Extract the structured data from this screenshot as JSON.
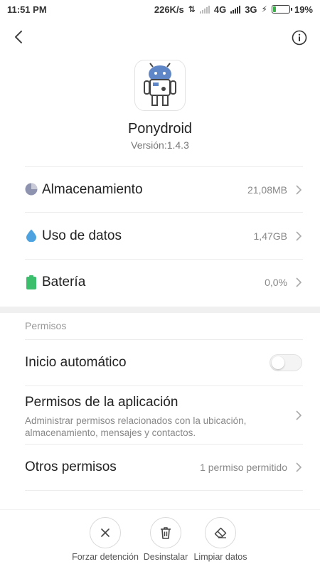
{
  "status_bar": {
    "time": "11:51 PM",
    "speed": "226K/s",
    "net1": "4G",
    "net2": "3G",
    "battery": "19%",
    "battery_level": 0.19
  },
  "app": {
    "name": "Ponydroid",
    "version": "Versión:1.4.3"
  },
  "usage": {
    "storage": {
      "label": "Almacenamiento",
      "value": "21,08MB"
    },
    "data": {
      "label": "Uso de datos",
      "value": "1,47GB"
    },
    "battery": {
      "label": "Batería",
      "value": "0,0%"
    }
  },
  "permissions": {
    "section_title": "Permisos",
    "autostart": {
      "label": "Inicio automático",
      "enabled": false
    },
    "app_permissions": {
      "label": "Permisos de la aplicación",
      "description": "Administrar permisos relacionados con la ubicación, almacenamiento, mensajes y contactos."
    },
    "other": {
      "label": "Otros permisos",
      "value": "1 permiso permitido"
    }
  },
  "actions": {
    "force_stop": "Forzar detención",
    "uninstall": "Desinstalar",
    "clear_data": "Limpiar datos"
  },
  "colors": {
    "storage_icon": "#8e93b0",
    "data_icon": "#4ca3e0",
    "battery_icon": "#3cbf6d"
  }
}
